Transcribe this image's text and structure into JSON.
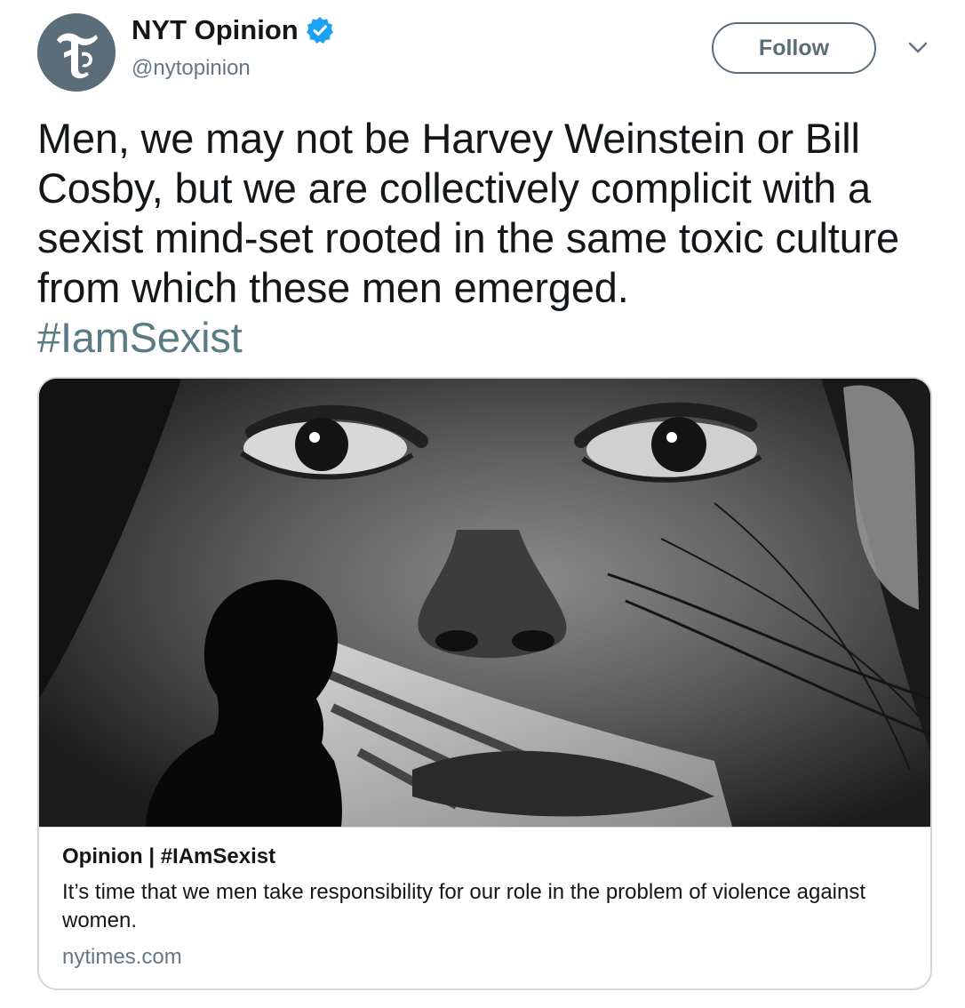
{
  "author": {
    "display_name": "NYT Opinion",
    "handle": "@nytopinion",
    "verified": true,
    "avatar_icon": "nyt-t-logo-icon",
    "avatar_color": "#5b6d78"
  },
  "actions": {
    "follow_label": "Follow",
    "menu_icon": "chevron-down-icon"
  },
  "tweet": {
    "text": "Men, we may not be Harvey Weinstein or Bill Cosby, but we are collectively complicit with a sexist mind-set rooted in the same toxic culture from which these men emerged.",
    "hashtag": "#IamSexist"
  },
  "card": {
    "image_icon": "silhouette-before-mural-photo",
    "title": "Opinion | #IAmSexist",
    "description": "It’s time that we men take responsibility for our role in the problem of violence against women.",
    "domain": "nytimes.com"
  },
  "colors": {
    "text": "#14171a",
    "secondary": "#657786",
    "hashtag": "#5a7a84",
    "verified": "#1da1f2",
    "border": "#cfd6dc"
  }
}
